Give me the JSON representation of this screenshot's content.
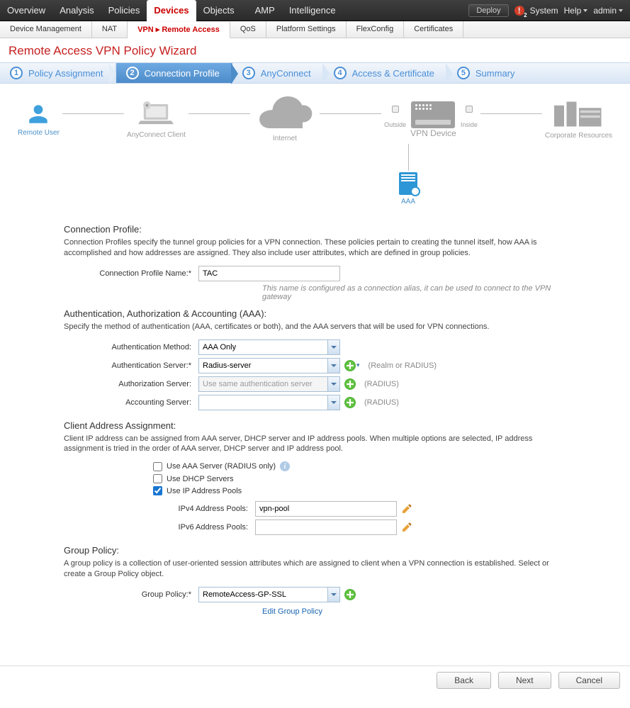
{
  "topbar": {
    "menu": [
      "Overview",
      "Analysis",
      "Policies",
      "Devices",
      "Objects",
      "AMP",
      "Intelligence"
    ],
    "active_index": 3,
    "deploy": "Deploy",
    "system": "System",
    "help": "Help",
    "user": "admin"
  },
  "subtabs": {
    "items": [
      "Device Management",
      "NAT",
      "VPN ▸ Remote Access",
      "QoS",
      "Platform Settings",
      "FlexConfig",
      "Certificates"
    ],
    "active_index": 2
  },
  "page_title": "Remote Access VPN Policy Wizard",
  "steps": {
    "items": [
      "Policy Assignment",
      "Connection Profile",
      "AnyConnect",
      "Access & Certificate",
      "Summary"
    ],
    "active_index": 1
  },
  "topology": {
    "remote_user": "Remote User",
    "anyconnect": "AnyConnect Client",
    "internet": "Internet",
    "outside": "Outside",
    "vpn_device": "VPN Device",
    "inside": "Inside",
    "corp": "Corporate Resources",
    "aaa": "AAA"
  },
  "conn_profile": {
    "heading": "Connection Profile:",
    "desc": "Connection Profiles specify the tunnel group policies for a VPN connection. These policies pertain to creating the tunnel itself, how AAA is accomplished and how addresses are assigned. They also include user attributes, which are defined in group policies.",
    "name_label": "Connection Profile Name:*",
    "name_value": "TAC",
    "name_note": "This name is configured as a connection alias, it can be used to connect to the VPN gateway"
  },
  "aaa": {
    "heading": "Authentication, Authorization & Accounting (AAA):",
    "desc": "Specify the method of authentication (AAA, certificates or both), and the AAA servers that will be used for VPN connections.",
    "auth_method_label": "Authentication Method:",
    "auth_method_value": "AAA Only",
    "auth_server_label": "Authentication Server:*",
    "auth_server_value": "Radius-server",
    "auth_server_hint": "(Realm or RADIUS)",
    "authz_server_label": "Authorization Server:",
    "authz_server_value": "Use same authentication server",
    "authz_hint": "(RADIUS)",
    "acct_server_label": "Accounting Server:",
    "acct_server_value": "",
    "acct_hint": "(RADIUS)"
  },
  "addr": {
    "heading": "Client Address Assignment:",
    "desc": "Client IP address can be assigned from AAA server, DHCP server and IP address pools. When multiple options are selected, IP address assignment is tried in the order of AAA server, DHCP server and IP address pool.",
    "use_aaa": "Use AAA Server (RADIUS only)",
    "use_dhcp": "Use DHCP Servers",
    "use_pools": "Use IP Address Pools",
    "ipv4_label": "IPv4 Address Pools:",
    "ipv4_value": "vpn-pool",
    "ipv6_label": "IPv6 Address Pools:",
    "ipv6_value": ""
  },
  "gp": {
    "heading": "Group Policy:",
    "desc": "A group policy is a collection of user-oriented session attributes which are assigned to client when a VPN connection is established. Select or create a Group Policy object.",
    "label": "Group Policy:*",
    "value": "RemoteAccess-GP-SSL",
    "edit_link": "Edit Group Policy"
  },
  "footer": {
    "back": "Back",
    "next": "Next",
    "cancel": "Cancel"
  }
}
